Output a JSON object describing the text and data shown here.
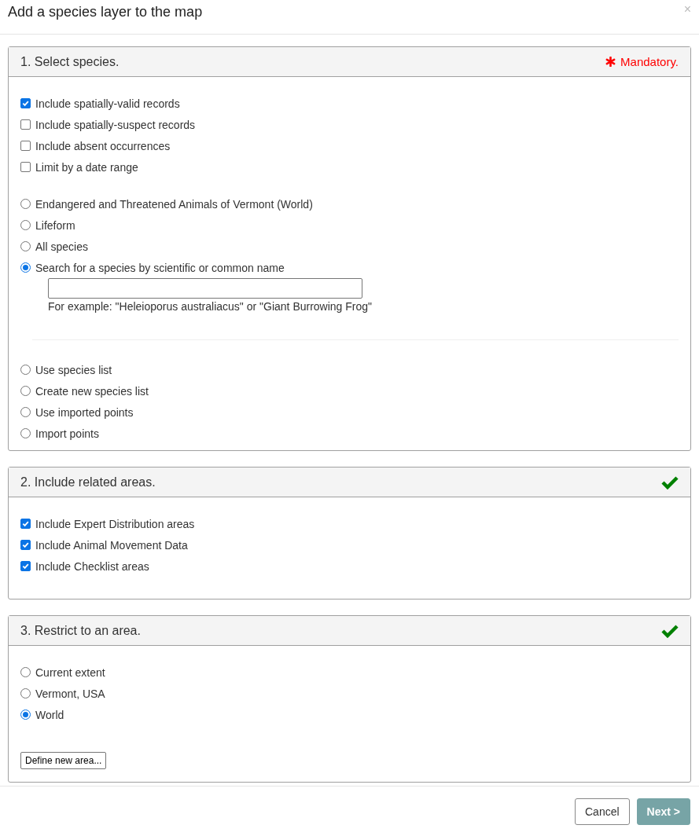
{
  "dialog": {
    "title": "Add a species layer to the map",
    "close": "×"
  },
  "sections": [
    {
      "title": "1. Select species.",
      "status": {
        "kind": "mandatory",
        "text": "Mandatory."
      },
      "groups": [
        {
          "kind": "checkbox",
          "divider_before": false,
          "items": [
            {
              "label": "Include spatially-valid records",
              "checked": true
            },
            {
              "label": "Include spatially-suspect records",
              "checked": false
            },
            {
              "label": "Include absent occurrences",
              "checked": false
            },
            {
              "label": "Limit by a date range",
              "checked": false
            }
          ]
        },
        {
          "kind": "radio",
          "divider_before": false,
          "items": [
            {
              "label": "Endangered and Threatened Animals of Vermont (World)",
              "selected": false
            },
            {
              "label": "Lifeform",
              "selected": false
            },
            {
              "label": "All species",
              "selected": false
            },
            {
              "label": "Search for a species by scientific or common name",
              "selected": true,
              "search": {
                "hint": "For example: \"Heleioporus australiacus\" or \"Giant Burrowing Frog\""
              }
            }
          ]
        },
        {
          "kind": "radio",
          "divider_before": true,
          "items": [
            {
              "label": "Use species list",
              "selected": false
            },
            {
              "label": "Create new species list",
              "selected": false
            },
            {
              "label": "Use imported points",
              "selected": false
            },
            {
              "label": "Import points",
              "selected": false
            }
          ]
        }
      ]
    },
    {
      "title": "2. Include related areas.",
      "status": {
        "kind": "done"
      },
      "groups": [
        {
          "kind": "checkbox",
          "divider_before": false,
          "items": [
            {
              "label": "Include Expert Distribution areas",
              "checked": true
            },
            {
              "label": "Include Animal Movement Data",
              "checked": true
            },
            {
              "label": "Include Checklist areas",
              "checked": true
            }
          ]
        }
      ]
    },
    {
      "title": "3. Restrict to an area.",
      "status": {
        "kind": "done"
      },
      "groups": [
        {
          "kind": "radio",
          "divider_before": false,
          "items": [
            {
              "label": "Current extent",
              "selected": false
            },
            {
              "label": "Vermont, USA",
              "selected": false
            },
            {
              "label": "World",
              "selected": true
            }
          ]
        }
      ],
      "button": "Define new area..."
    }
  ],
  "footer": {
    "buttons": [
      {
        "label": "Cancel",
        "kind": "secondary",
        "disabled": false
      },
      {
        "label": "Next >",
        "kind": "primary",
        "disabled": true
      }
    ]
  }
}
